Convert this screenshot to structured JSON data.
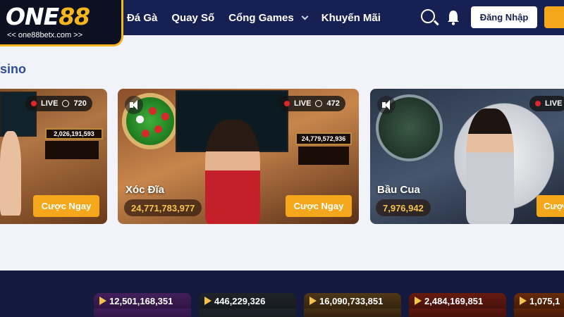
{
  "header": {
    "logo_text": "ONE88",
    "logo_url": "<< one88betx.com >>",
    "nav": [
      "Đá Gà",
      "Quay Số",
      "Cổng Games",
      "Khuyến Mãi"
    ],
    "login_label": "Đăng Nhập"
  },
  "section": {
    "title": "asino"
  },
  "cards": [
    {
      "live": "LIVE",
      "viewers": "720",
      "board_value": "2,026,191,593",
      "play_label": "Cược Ngay"
    },
    {
      "name": "Xóc Đĩa",
      "live": "LIVE",
      "viewers": "472",
      "board_value": "24,779,572,936",
      "jackpot": "24,771,783,977",
      "play_label": "Cược Ngay"
    },
    {
      "name": "Bầu Cua",
      "live": "LIVE",
      "jackpot": "7,976,942",
      "play_label": "Cược"
    }
  ],
  "thumbnails": [
    "12,501,168,351",
    "446,229,326",
    "16,090,733,851",
    "2,484,169,851",
    "1,075,1"
  ],
  "colors": {
    "header_bg": "#172052",
    "accent": "#f5a71b",
    "section_title": "#2d4c97",
    "live_dot": "#e3242b"
  }
}
